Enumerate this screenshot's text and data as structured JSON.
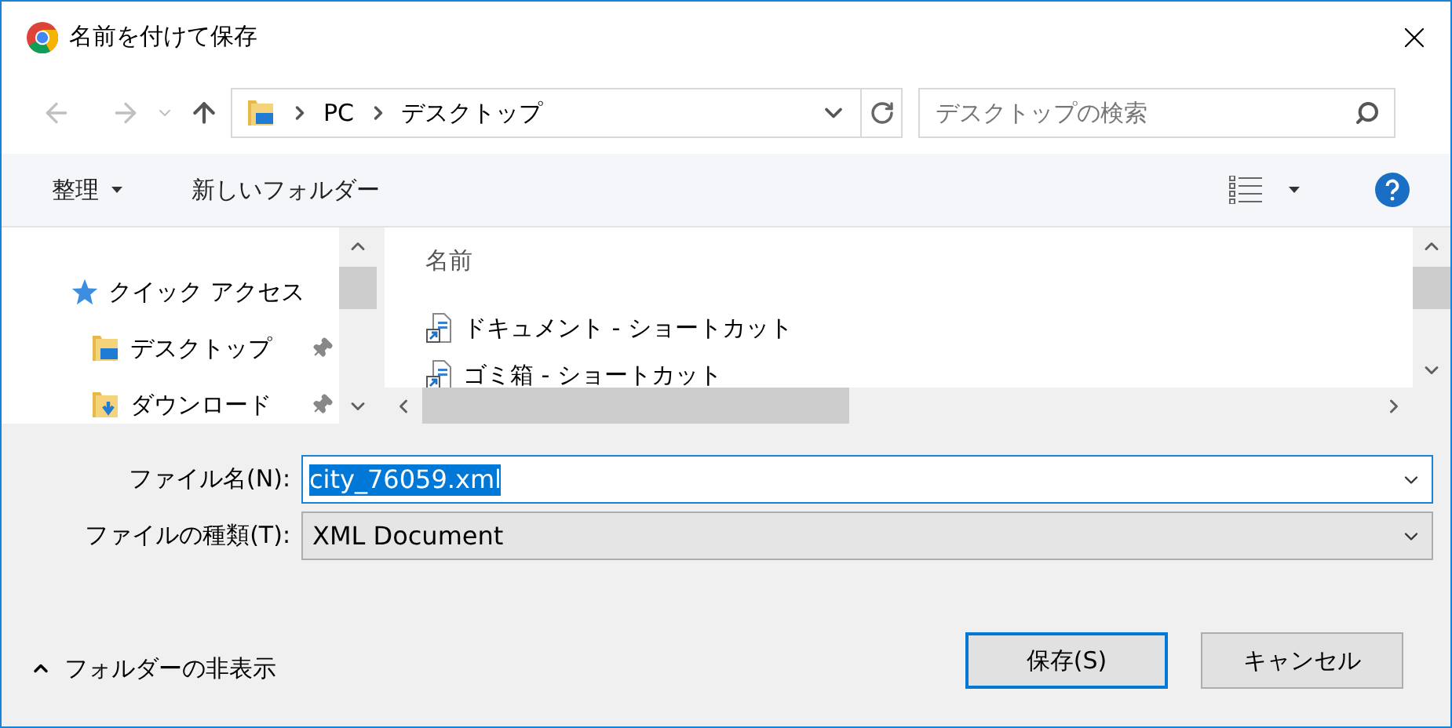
{
  "window": {
    "title": "名前を付けて保存"
  },
  "address_bar": {
    "path": [
      "PC",
      "デスクトップ"
    ]
  },
  "search": {
    "placeholder": "デスクトップの検索"
  },
  "toolbar": {
    "organize": "整理",
    "new_folder": "新しいフォルダー"
  },
  "nav_pane": {
    "items": [
      {
        "label": "クイック アクセス",
        "kind": "quick-access"
      },
      {
        "label": "デスクトップ",
        "kind": "desktop"
      },
      {
        "label": "ダウンロード",
        "kind": "downloads"
      }
    ]
  },
  "file_list": {
    "column": "名前",
    "items": [
      {
        "label": "ドキュメント - ショートカット"
      },
      {
        "label": "ゴミ箱 - ショートカット"
      }
    ]
  },
  "file_name": {
    "label": "ファイル名(N):",
    "value": "city_76059.xml",
    "selected": true
  },
  "file_type": {
    "label": "ファイルの種類(T):",
    "value": "XML Document"
  },
  "hide_folders": "フォルダーの非表示",
  "buttons": [
    {
      "label": "保存(S)",
      "default": true
    },
    {
      "label": "キャンセル",
      "default": false
    }
  ]
}
